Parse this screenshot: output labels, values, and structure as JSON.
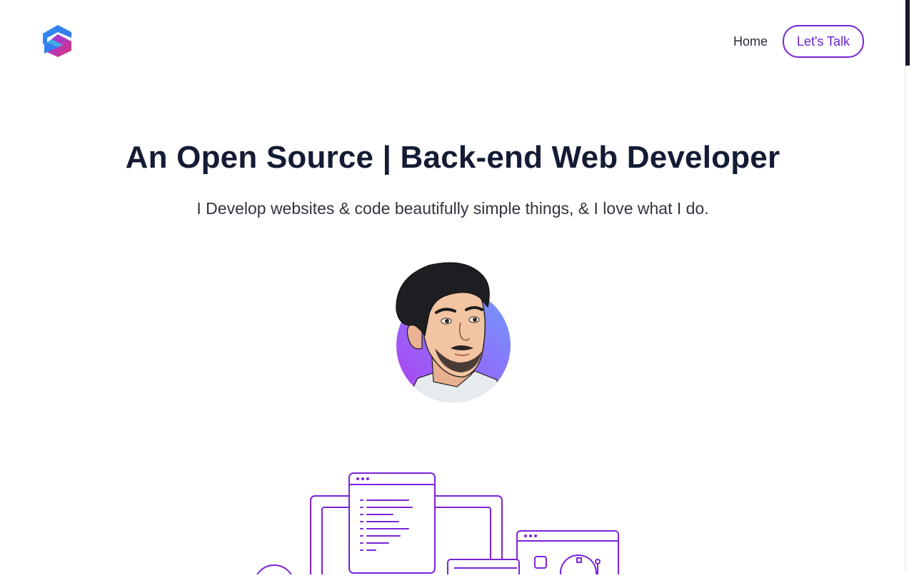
{
  "nav": {
    "logo_icon": "brand-s-logo",
    "home_label": "Home",
    "cta_label": "Let's Talk"
  },
  "hero": {
    "title": "An Open Source | Back-end Web Developer",
    "subtitle": "I Develop websites & code beautifully simple things, & I love what I do."
  },
  "colors": {
    "accent": "#7b23d8",
    "heading": "#141b34",
    "avatar_gradient_start": "#a33ff0",
    "avatar_gradient_end": "#6f8cff"
  },
  "icons": {
    "avatar": "developer-avatar-illustration",
    "devices": "devices-line-illustration"
  }
}
